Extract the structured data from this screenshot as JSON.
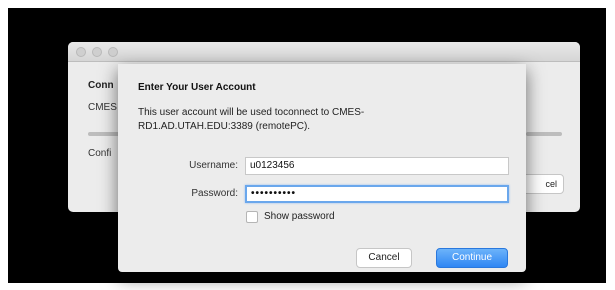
{
  "background_window": {
    "title_partial": "Conn",
    "subtitle_partial": "CMES",
    "config_partial": "Confi",
    "cancel_partial": "cel"
  },
  "sheet": {
    "title": "Enter Your User Account",
    "description": "This user account will be used toconnect to CMES-RD1.AD.UTAH.EDU:3389 (remotePC).",
    "username_label": "Username:",
    "username_value": "u0123456",
    "password_label": "Password:",
    "password_value": "••••••••••",
    "show_password_label": "Show password",
    "show_password_checked": false,
    "cancel_label": "Cancel",
    "continue_label": "Continue"
  },
  "colors": {
    "accent": "#2f86f3",
    "focus_ring": "#6aa7ec",
    "backdrop": "#000000"
  }
}
